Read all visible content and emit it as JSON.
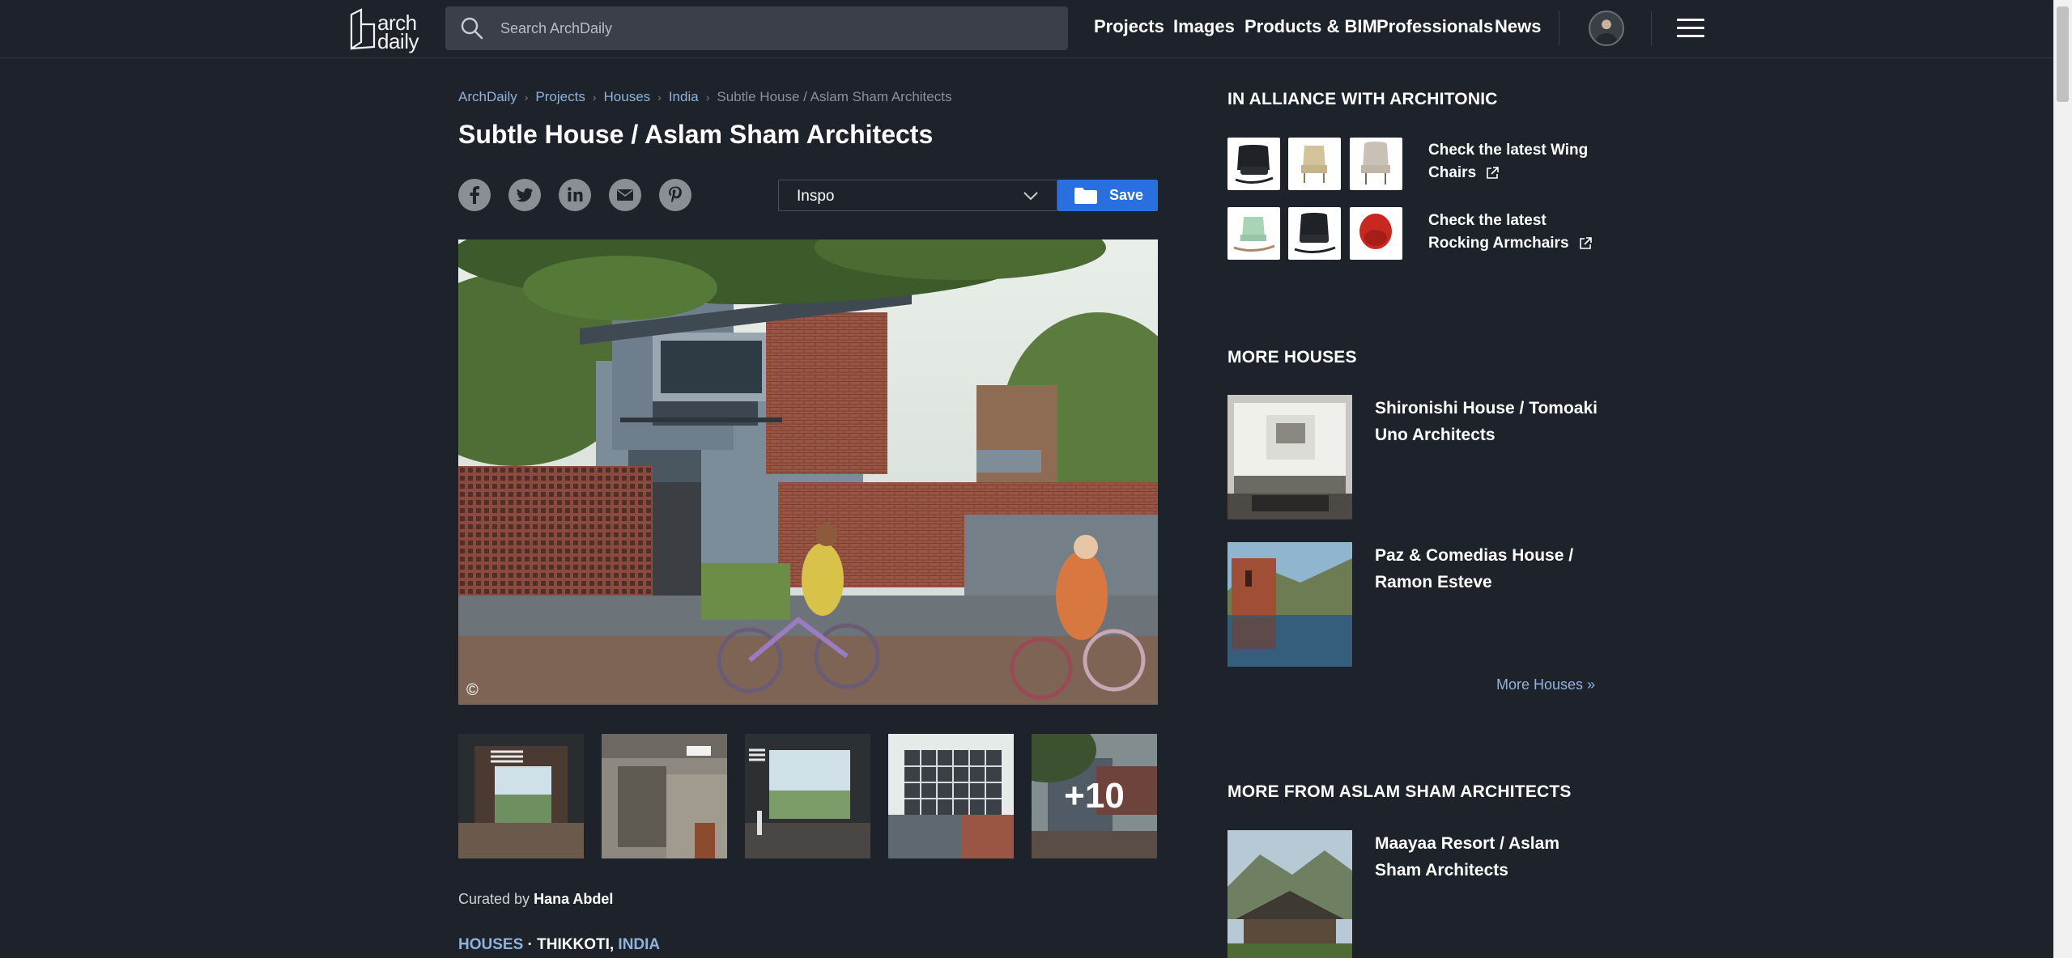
{
  "header": {
    "logo_line1": "arch",
    "logo_line2": "daily",
    "search_placeholder": "Search ArchDaily",
    "nav": [
      "Projects",
      "Images",
      "Products & BIM",
      "Professionals",
      "News"
    ],
    "icons": {
      "search": "search-icon",
      "menu": "hamburger-menu-icon",
      "avatar": "user-avatar"
    }
  },
  "breadcrumb": [
    "ArchDaily",
    "Projects",
    "Houses",
    "India"
  ],
  "breadcrumb_current": "Subtle House / Aslam Sham Architects",
  "article": {
    "title": "Subtle House / Aslam Sham Architects",
    "share_icons": [
      "facebook-icon",
      "twitter-icon",
      "linkedin-icon",
      "email-icon",
      "pinterest-icon"
    ],
    "folder_select": "Inspo",
    "save_label": "Save",
    "copyright": "©",
    "more_images": "+10",
    "curated_prefix": "Curated by",
    "curator": "Hana Abdel",
    "tag_category": "HOUSES",
    "tag_separator": "·",
    "tag_city": "THIKKOTI,",
    "tag_country": "INDIA"
  },
  "sidebar": {
    "alliance_title": "IN ALLIANCE WITH ARCHITONIC",
    "alliance_links": [
      "Check the latest Wing Chairs",
      "Check the latest Rocking Armchairs"
    ],
    "more_houses_title": "MORE HOUSES",
    "more_houses": [
      "Shironishi House / Tomoaki Uno Architects",
      "Paz & Comedias House / Ramon Esteve"
    ],
    "more_houses_link": "More Houses »",
    "more_from_title": "MORE FROM ASLAM SHAM ARCHITECTS",
    "more_from": [
      "Maayaa Resort / Aslam Sham Architects"
    ]
  },
  "colors": {
    "background": "#1e222b",
    "link": "#8fb3dd",
    "save_button": "#2a6fe0",
    "search_bg": "#3a3f49"
  }
}
